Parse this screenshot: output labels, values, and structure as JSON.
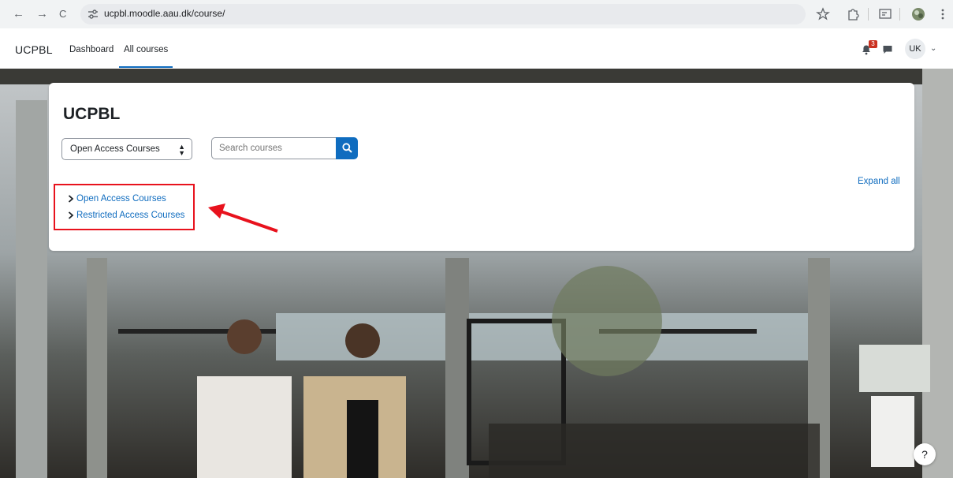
{
  "browser": {
    "url": "ucpbl.moodle.aau.dk/course/",
    "back_icon": "←",
    "forward_icon": "→",
    "reload_icon": "C"
  },
  "topnav": {
    "brand": "UCPBL",
    "links": [
      {
        "label": "Dashboard",
        "active": false
      },
      {
        "label": "All courses",
        "active": true
      }
    ],
    "notification_count": "3",
    "user_initials": "UK"
  },
  "card": {
    "title": "UCPBL",
    "category_select": {
      "selected": "Open Access Courses"
    },
    "search": {
      "placeholder": "Search courses"
    },
    "expand_all": "Expand all",
    "categories": [
      {
        "label": "Open Access Courses"
      },
      {
        "label": "Restricted Access Courses"
      }
    ]
  },
  "help_button": "?",
  "colors": {
    "accent": "#0f6cbf",
    "highlight": "#e8121d",
    "badge": "#ca3120"
  }
}
